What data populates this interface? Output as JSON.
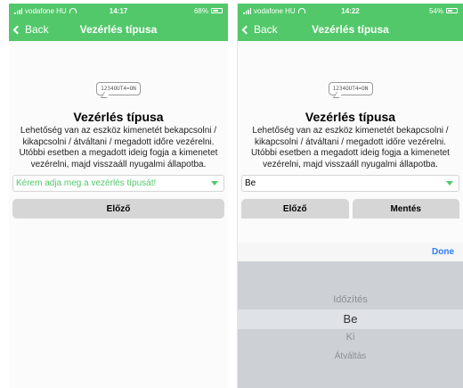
{
  "phones": [
    {
      "status": {
        "carrier": "vodafone HU",
        "time": "14:17",
        "battery": "68%",
        "battery_level": 0.68
      },
      "nav": {
        "back": "Back",
        "title": "Vezérlés típusa"
      },
      "badge": "1234OUT4=ON",
      "heading": "Vezérlés típusa",
      "description": "Lehetőség van az eszköz kimenetét bekapcsolni / kikapcsolni / átváltani / megadott időre vezérelni. Utóbbi esetben a megadott ideig fogja a kimenetet vezérelni, majd visszaáll nyugalmi állapotba.",
      "select": {
        "text": "Kérem adja meg a vezérlés típusát!"
      },
      "buttons": {
        "prev": "Előző"
      }
    },
    {
      "status": {
        "carrier": "vodafone HU",
        "time": "14:22",
        "battery": "54%",
        "battery_level": 0.54
      },
      "nav": {
        "back": "Back",
        "title": "Vezérlés típusa"
      },
      "badge": "1234OUT4=ON",
      "heading": "Vezérlés típusa",
      "description": "Lehetőség van az eszköz kimenetét bekapcsolni / kikapcsolni / átváltani / megadott időre vezérelni. Utóbbi esetben a megadott ideig fogja a kimenetet vezérelni, majd visszaáll nyugalmi állapotba.",
      "select": {
        "text": "Be"
      },
      "buttons": {
        "prev": "Előző",
        "save": "Mentés"
      },
      "picker": {
        "done": "Done",
        "options": [
          "Időzítés",
          "Be",
          "Ki",
          "Átváltás"
        ],
        "selected": "Be"
      }
    }
  ],
  "colors": {
    "accent": "#52c86a",
    "done": "#2d7cf6",
    "button": "#d6d6d6"
  }
}
